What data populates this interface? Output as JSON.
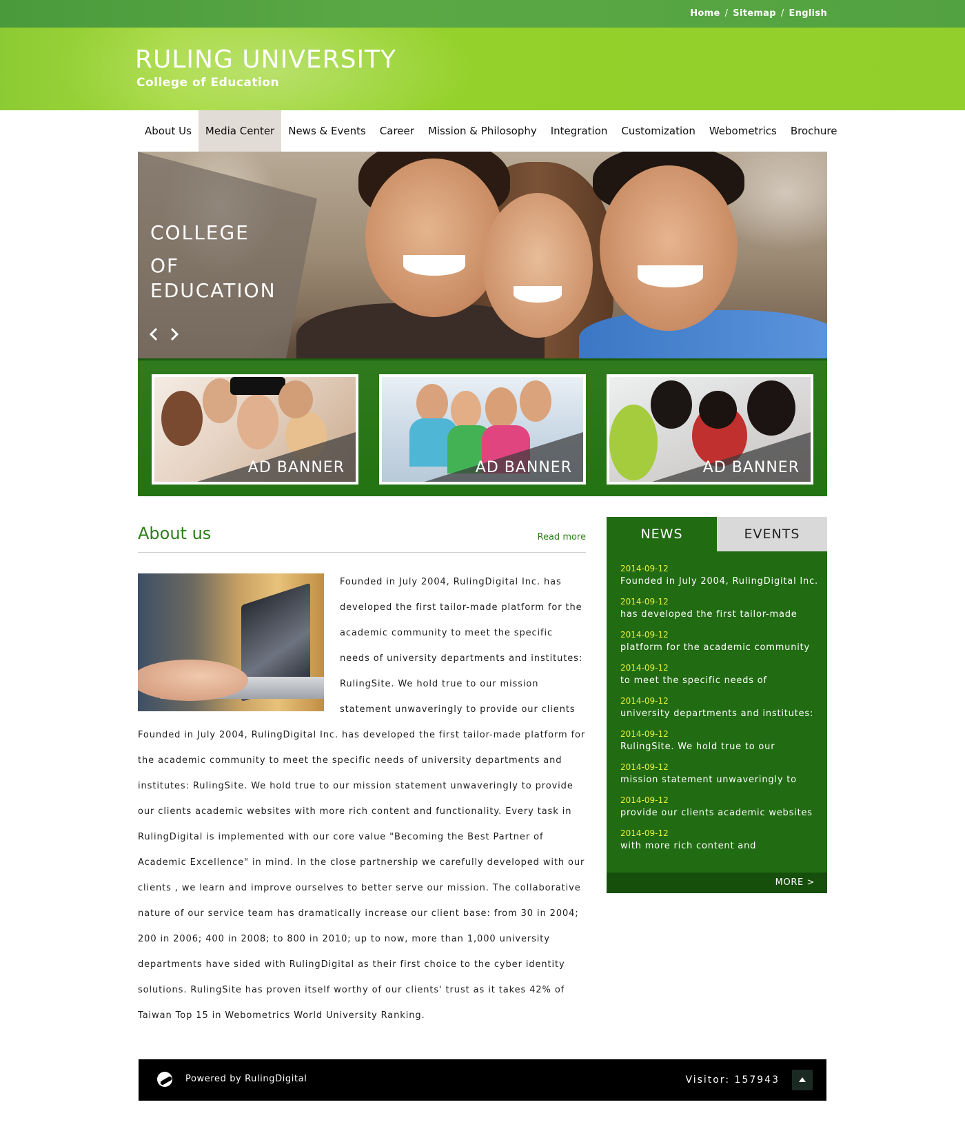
{
  "topbar": {
    "links": [
      "Home",
      "Sitemap",
      "English"
    ],
    "separator": "/"
  },
  "site": {
    "title": "RULING UNIVERSITY",
    "subtitle": "College of Education"
  },
  "nav": {
    "items": [
      "About Us",
      "Media Center",
      "News & Events",
      "Career",
      "Mission & Philosophy",
      "Integration",
      "Customization",
      "Webometrics",
      "Brochure"
    ],
    "active": "Media Center"
  },
  "hero": {
    "caption": [
      "COLLEGE",
      "OF",
      "EDUCATION"
    ],
    "prev_icon": "chevron-left-icon",
    "next_icon": "chevron-right-icon"
  },
  "ads": [
    {
      "label": "AD BANNER"
    },
    {
      "label": "AD BANNER"
    },
    {
      "label": "AD BANNER"
    }
  ],
  "about": {
    "title": "About us",
    "read_more": "Read more",
    "text": "Founded in July 2004, RulingDigital Inc. has developed the first tailor-made platform for the academic community to meet the specific needs of university departments and institutes: RulingSite. We hold true to our mission statement unwaveringly to provide our clients Founded in July 2004, RulingDigital Inc. has developed the first tailor-made platform for the academic community to meet the specific needs of university departments and institutes: RulingSite. We hold true to our mission statement unwaveringly to provide our clients academic websites with more rich content and functionality. Every task in RulingDigital is implemented with our core value \"Becoming the Best Partner of Academic Excellence\" in mind. In the close partnership we carefully developed with our clients , we learn and improve ourselves to better serve our mission. The collaborative nature of our service team has dramatically increase our client base: from 30 in 2004; 200 in 2006; 400 in 2008; to 800 in 2010; up to now, more than 1,000 university departments have sided with RulingDigital as their first choice to the cyber identity solutions. RulingSite has proven itself worthy of our clients' trust as it takes 42% of Taiwan Top 15 in Webometrics World University Ranking."
  },
  "news": {
    "tabs": [
      "NEWS",
      "EVENTS"
    ],
    "active_tab": "NEWS",
    "items": [
      {
        "date": "2014-09-12",
        "title": "Founded in July 2004, RulingDigital Inc."
      },
      {
        "date": "2014-09-12",
        "title": "has developed the first tailor-made"
      },
      {
        "date": "2014-09-12",
        "title": "platform for the academic community"
      },
      {
        "date": "2014-09-12",
        "title": "to meet the specific needs of"
      },
      {
        "date": "2014-09-12",
        "title": "university departments and institutes:"
      },
      {
        "date": "2014-09-12",
        "title": "RulingSite. We hold true to our"
      },
      {
        "date": "2014-09-12",
        "title": "mission statement unwaveringly to"
      },
      {
        "date": "2014-09-12",
        "title": "provide our clients academic websites"
      },
      {
        "date": "2014-09-12",
        "title": "with more rich content and"
      }
    ],
    "more": "MORE >"
  },
  "footer": {
    "powered": "Powered by RulingDigital",
    "visitor": "Visitor: 157943",
    "logo_icon": "rulingdigital-logo-icon",
    "top_icon": "arrow-up-icon"
  },
  "colors": {
    "green_dark": "#216b12",
    "green_light": "#93cf2c",
    "date_yellow": "#e6f23a",
    "footer_bg": "#000000"
  }
}
